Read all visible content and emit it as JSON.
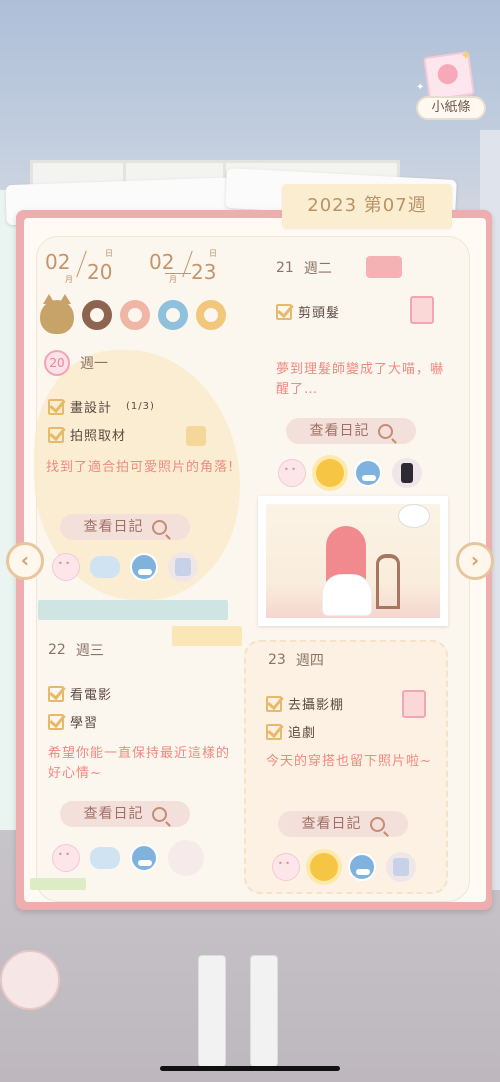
{
  "note_widget": {
    "label": "小紙條"
  },
  "week_tab": "2023 第07週",
  "date_range": {
    "start_month": "02",
    "start_day": "20",
    "end_month": "02",
    "end_day": "23",
    "month_unit": "月",
    "day_unit": "日"
  },
  "days": [
    {
      "num": "20",
      "weekday": "週一",
      "todos": [
        {
          "label": "畫設計",
          "progress": "(1/3)"
        },
        {
          "label": "拍照取材",
          "progress": ""
        }
      ],
      "note": "找到了適合拍可愛照片的角落!",
      "diary_button": "查看日記"
    },
    {
      "num": "21",
      "weekday": "週二",
      "todos": [
        {
          "label": "剪頭髮",
          "progress": ""
        }
      ],
      "note": "夢到理髮師變成了大喵，嚇醒了…",
      "diary_button": "查看日記"
    },
    {
      "num": "22",
      "weekday": "週三",
      "todos": [
        {
          "label": "看電影",
          "progress": ""
        },
        {
          "label": "學習",
          "progress": ""
        }
      ],
      "note": "希望你能一直保持最近這樣的好心情~",
      "diary_button": "查看日記"
    },
    {
      "num": "23",
      "weekday": "週四",
      "todos": [
        {
          "label": "去攝影棚",
          "progress": ""
        },
        {
          "label": "追劇",
          "progress": ""
        }
      ],
      "note": "今天的穿搭也留下照片啦~",
      "diary_button": "查看日記"
    }
  ],
  "nav": {
    "prev_glyph": "‹",
    "next_glyph": "›"
  },
  "colors": {
    "book_border": "#eeaeb0",
    "accent_text": "#ef8a80",
    "check": "#e9b96a"
  }
}
